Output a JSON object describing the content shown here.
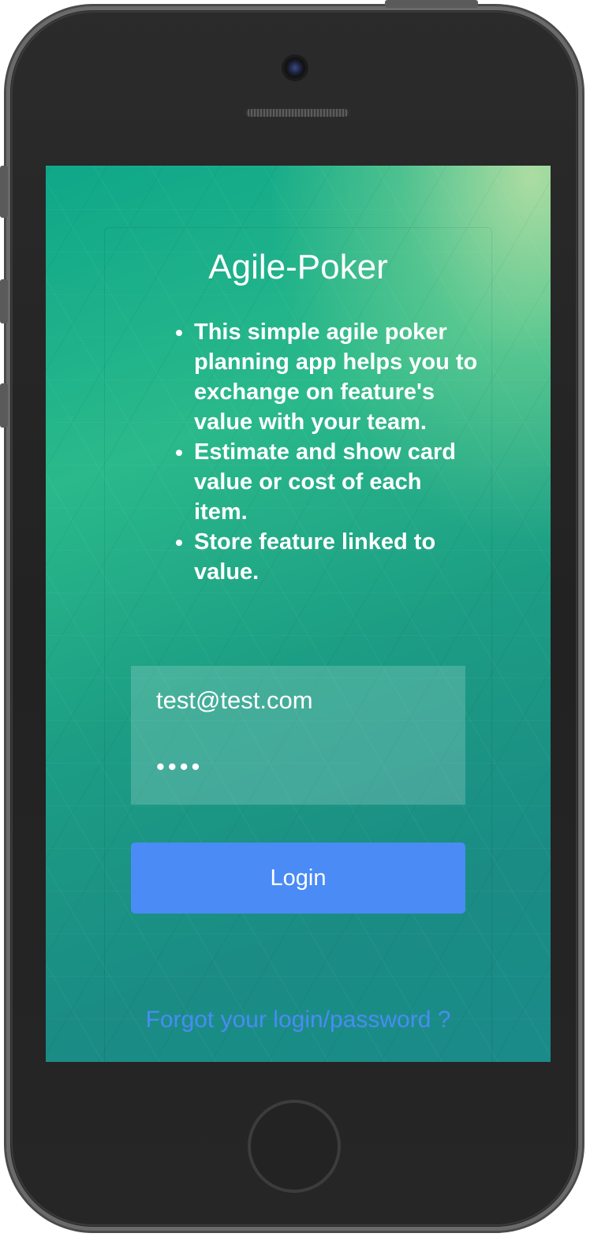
{
  "app": {
    "title": "Agile-Poker"
  },
  "features": [
    "This simple agile poker planning app helps you to exchange on feature's value with your team.",
    "Estimate and show card value or cost of each item.",
    "Store feature linked to value."
  ],
  "form": {
    "email_value": "test@test.com",
    "password_value": "••••"
  },
  "login_button": {
    "label": "Login"
  },
  "forgot_link": {
    "label": "Forgot your login/password ?"
  },
  "colors": {
    "accent": "#4a8bf5",
    "background_green": "#1c9d84",
    "device_body": "#232323"
  },
  "icons": {
    "camera": "camera-icon",
    "speaker": "speaker-grille-icon",
    "home": "home-button-icon"
  }
}
